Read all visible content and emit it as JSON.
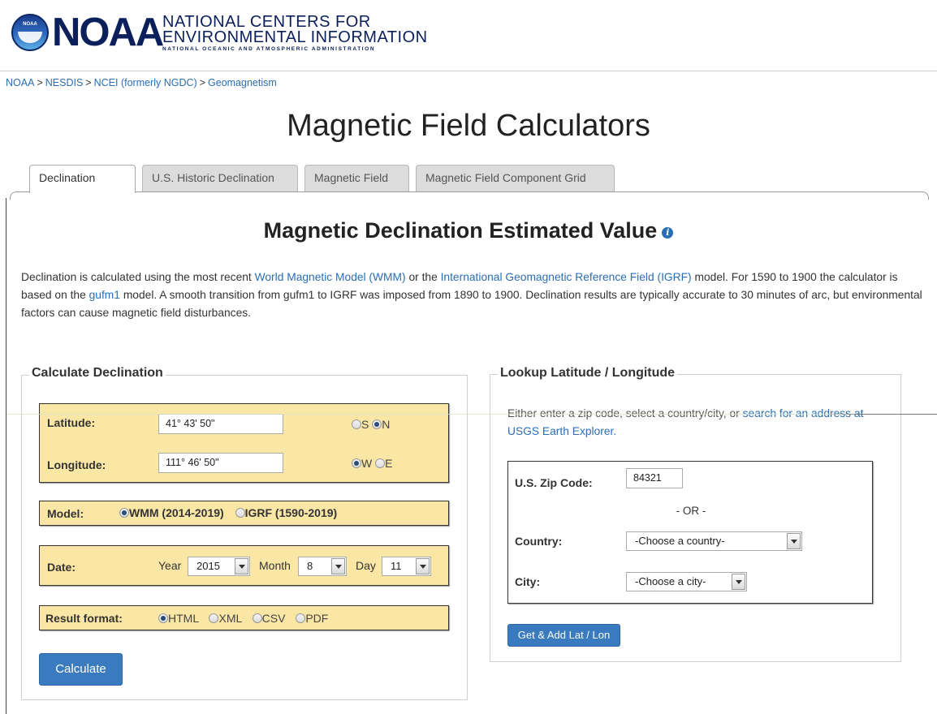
{
  "header": {
    "logo_text": "NOAA",
    "center_line1": "NATIONAL CENTERS FOR",
    "center_line2": "ENVIRONMENTAL INFORMATION",
    "center_line3": "NATIONAL OCEANIC AND ATMOSPHERIC ADMINISTRATION",
    "seal_text": "NOAA"
  },
  "breadcrumb": [
    "NOAA",
    "NESDIS",
    "NCEI (formerly NGDC)",
    "Geomagnetism"
  ],
  "breadcrumb_sep": ">",
  "page_title": "Magnetic Field Calculators",
  "tabs": [
    {
      "label": "Declination",
      "active": true
    },
    {
      "label": "U.S. Historic Declination",
      "active": false
    },
    {
      "label": "Magnetic Field",
      "active": false
    },
    {
      "label": "Magnetic Field Component Grid",
      "active": false
    }
  ],
  "section_title": "Magnetic Declination Estimated Value",
  "info_icon": "i",
  "description": {
    "part1": "Declination is calculated using the most recent ",
    "link1": "World Magnetic Model (WMM)",
    "part2": " or the ",
    "link2": "International Geomagnetic Reference Field (IGRF)",
    "part3": " model. For 1590 to 1900 the calculator is based on the ",
    "link3": "gufm1",
    "part4": " model. A smooth transition from gufm1 to IGRF was imposed from 1890 to 1900. Declination results are typically accurate to 30 minutes of arc, but environmental factors can cause magnetic field disturbances."
  },
  "calc": {
    "legend": "Calculate Declination",
    "latitude_label": "Latitude:",
    "latitude_value": "41° 43' 50\"",
    "lat_s": "S",
    "lat_n": "N",
    "longitude_label": "Longitude:",
    "longitude_value": "111° 46' 50\"",
    "lon_w": "W",
    "lon_e": "E",
    "model_label": "Model:",
    "model_wmm": "WMM (2014-2019)",
    "model_igrf": "IGRF (1590-2019)",
    "date_label": "Date:",
    "year_label": "Year",
    "year_value": "2015",
    "month_label": "Month",
    "month_value": "8",
    "day_label": "Day",
    "day_value": "11",
    "result_label": "Result format:",
    "fmt_html": "HTML",
    "fmt_xml": "XML",
    "fmt_csv": "CSV",
    "fmt_pdf": "PDF",
    "calculate_button": "Calculate"
  },
  "lookup": {
    "legend": "Lookup Latitude / Longitude",
    "intro_text": "Either enter a zip code, select a country/city, or ",
    "intro_link": "search for an address at USGS Earth Explorer.",
    "zip_label": "U.S. Zip Code:",
    "zip_value": "84321",
    "or_text": "- OR -",
    "country_label": "Country:",
    "country_value": "-Choose a country-",
    "city_label": "City:",
    "city_value": "-Choose a city-",
    "button": "Get & Add Lat / Lon"
  },
  "colors": {
    "link": "#2a6eb5",
    "panel": "#fbe7a5",
    "button": "#3a7bbf",
    "logo": "#0b1f5a"
  }
}
